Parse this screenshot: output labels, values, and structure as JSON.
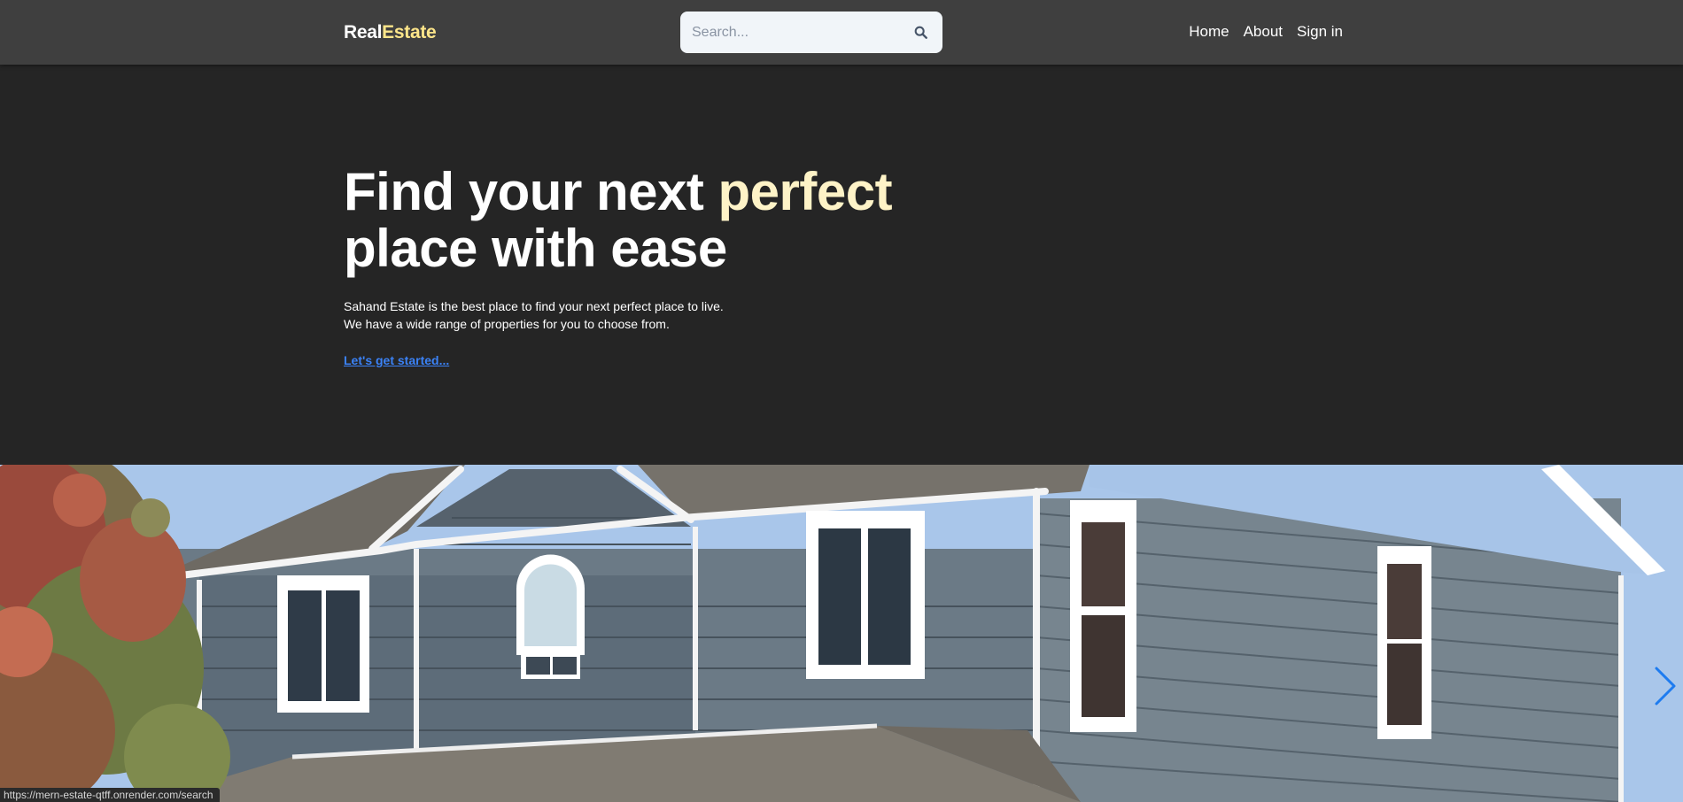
{
  "header": {
    "logo_part1": "Real",
    "logo_part2": "Estate",
    "search_placeholder": "Search...",
    "search_icon": "search-icon",
    "nav": {
      "home": "Home",
      "about": "About",
      "signin": "Sign in"
    }
  },
  "hero": {
    "title_part1": "Find your next ",
    "title_highlight": "perfect",
    "title_part2": "place with ease",
    "description_line1": "Sahand Estate is the best place to find your next perfect place to live.",
    "description_line2": "We have a wide range of properties for you to choose from.",
    "cta": "Let's get started..."
  },
  "slider": {
    "next_icon": "chevron-right-icon"
  },
  "status_bar": {
    "url": "https://mern-estate-qtff.onrender.com/search"
  },
  "colors": {
    "header_bg": "#3f3f3f",
    "page_bg": "#252525",
    "logo_accent": "#fde68a",
    "title_highlight": "#fef3c7",
    "link": "#3b82f6",
    "slider_arrow": "#1d7bf0"
  }
}
